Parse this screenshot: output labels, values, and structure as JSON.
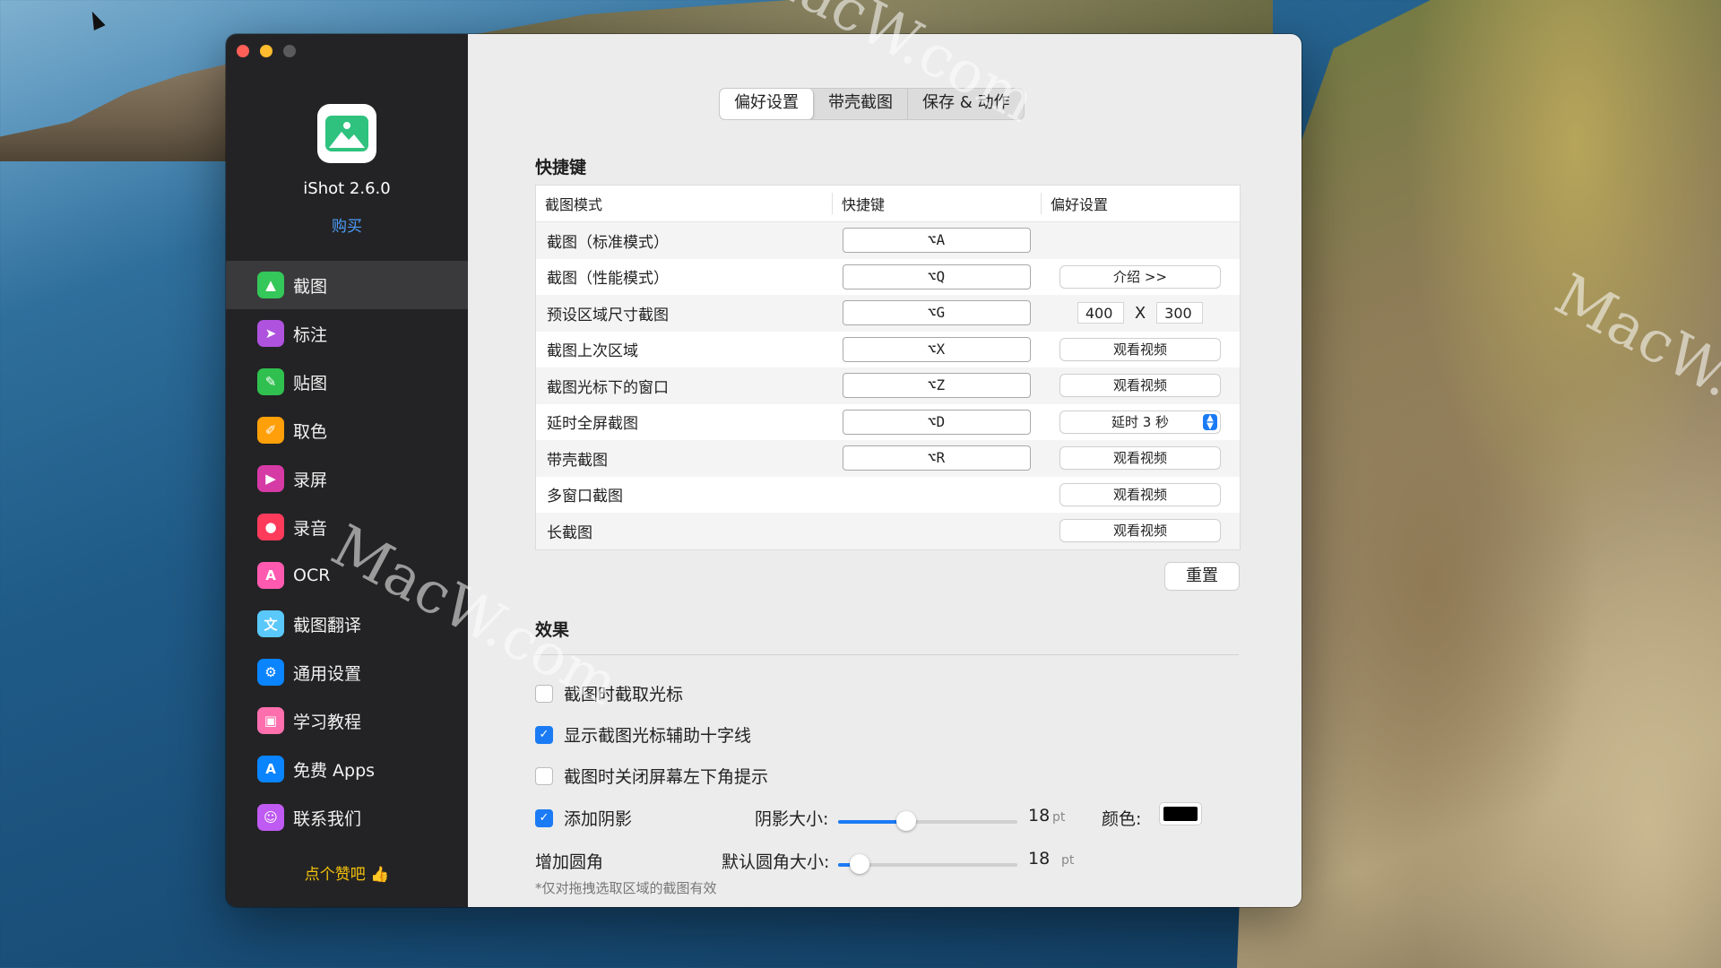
{
  "app": {
    "name": "iShot 2.6.0",
    "buy": "购买",
    "like": "点个赞吧 👍"
  },
  "sidebar": {
    "items": [
      {
        "label": "截图",
        "color": "#34c759",
        "icon": "▲",
        "active": true
      },
      {
        "label": "标注",
        "color": "#af52de",
        "icon": "➤"
      },
      {
        "label": "贴图",
        "color": "#30c04f",
        "icon": "✎"
      },
      {
        "label": "取色",
        "color": "#ff9f0a",
        "icon": "✐"
      },
      {
        "label": "录屏",
        "color": "#d63aa5",
        "icon": "▶"
      },
      {
        "label": "录音",
        "color": "#ff3b5c",
        "icon": "●"
      },
      {
        "label": "OCR",
        "color": "#ff5ab0",
        "icon": "A"
      },
      {
        "label": "截图翻译",
        "color": "#5ac8fa",
        "icon": "文"
      },
      {
        "label": "通用设置",
        "color": "#0a84ff",
        "icon": "⚙"
      },
      {
        "label": "学习教程",
        "color": "#ff6fae",
        "icon": "▣"
      },
      {
        "label": "免费 Apps",
        "color": "#0a84ff",
        "icon": "A"
      },
      {
        "label": "联系我们",
        "color": "#bf5af2",
        "icon": "☺"
      }
    ]
  },
  "tabs": [
    "偏好设置",
    "带壳截图",
    "保存 & 动作"
  ],
  "shortcuts": {
    "title": "快捷键",
    "headers": [
      "截图模式",
      "快捷键",
      "偏好设置"
    ],
    "rows": [
      {
        "mode": "截图（标准模式）",
        "key": "⌥A",
        "pref_type": "none"
      },
      {
        "mode": "截图（性能模式）",
        "key": "⌥Q",
        "pref_type": "button",
        "pref": "介绍  >>"
      },
      {
        "mode": "预设区域尺寸截图",
        "key": "⌥G",
        "pref_type": "size",
        "width": "400",
        "x": "X",
        "height": "300"
      },
      {
        "mode": "截图上次区域",
        "key": "⌥X",
        "pref_type": "button",
        "pref": "观看视频"
      },
      {
        "mode": "截图光标下的窗口",
        "key": "⌥Z",
        "pref_type": "button",
        "pref": "观看视频"
      },
      {
        "mode": "延时全屏截图",
        "key": "⌥D",
        "pref_type": "select",
        "pref": "延时 3 秒"
      },
      {
        "mode": "带壳截图",
        "key": "⌥R",
        "pref_type": "button",
        "pref": "观看视频"
      },
      {
        "mode": "多窗口截图",
        "key": "",
        "pref_type": "button",
        "pref": "观看视频"
      },
      {
        "mode": "长截图",
        "key": "",
        "pref_type": "button",
        "pref": "观看视频"
      }
    ],
    "reset": "重置"
  },
  "effects": {
    "title": "效果",
    "capture_cursor": {
      "label": "截图时截取光标",
      "checked": false
    },
    "crosshair": {
      "label": "显示截图光标辅助十字线",
      "checked": true
    },
    "hide_hint": {
      "label": "截图时关闭屏幕左下角提示",
      "checked": false
    },
    "shadow": {
      "label": "添加阴影",
      "checked": true,
      "size_label": "阴影大小:",
      "value": "18",
      "unit": "pt",
      "level": 0.38,
      "color_label": "颜色:",
      "color": "#000000"
    },
    "corner": {
      "label": "增加圆角",
      "size_label": "默认圆角大小:",
      "value": "18",
      "unit": "pt",
      "level": 0.12,
      "note": "*仅对拖拽选取区域的截图有效"
    }
  },
  "watermark": "MacW.com"
}
